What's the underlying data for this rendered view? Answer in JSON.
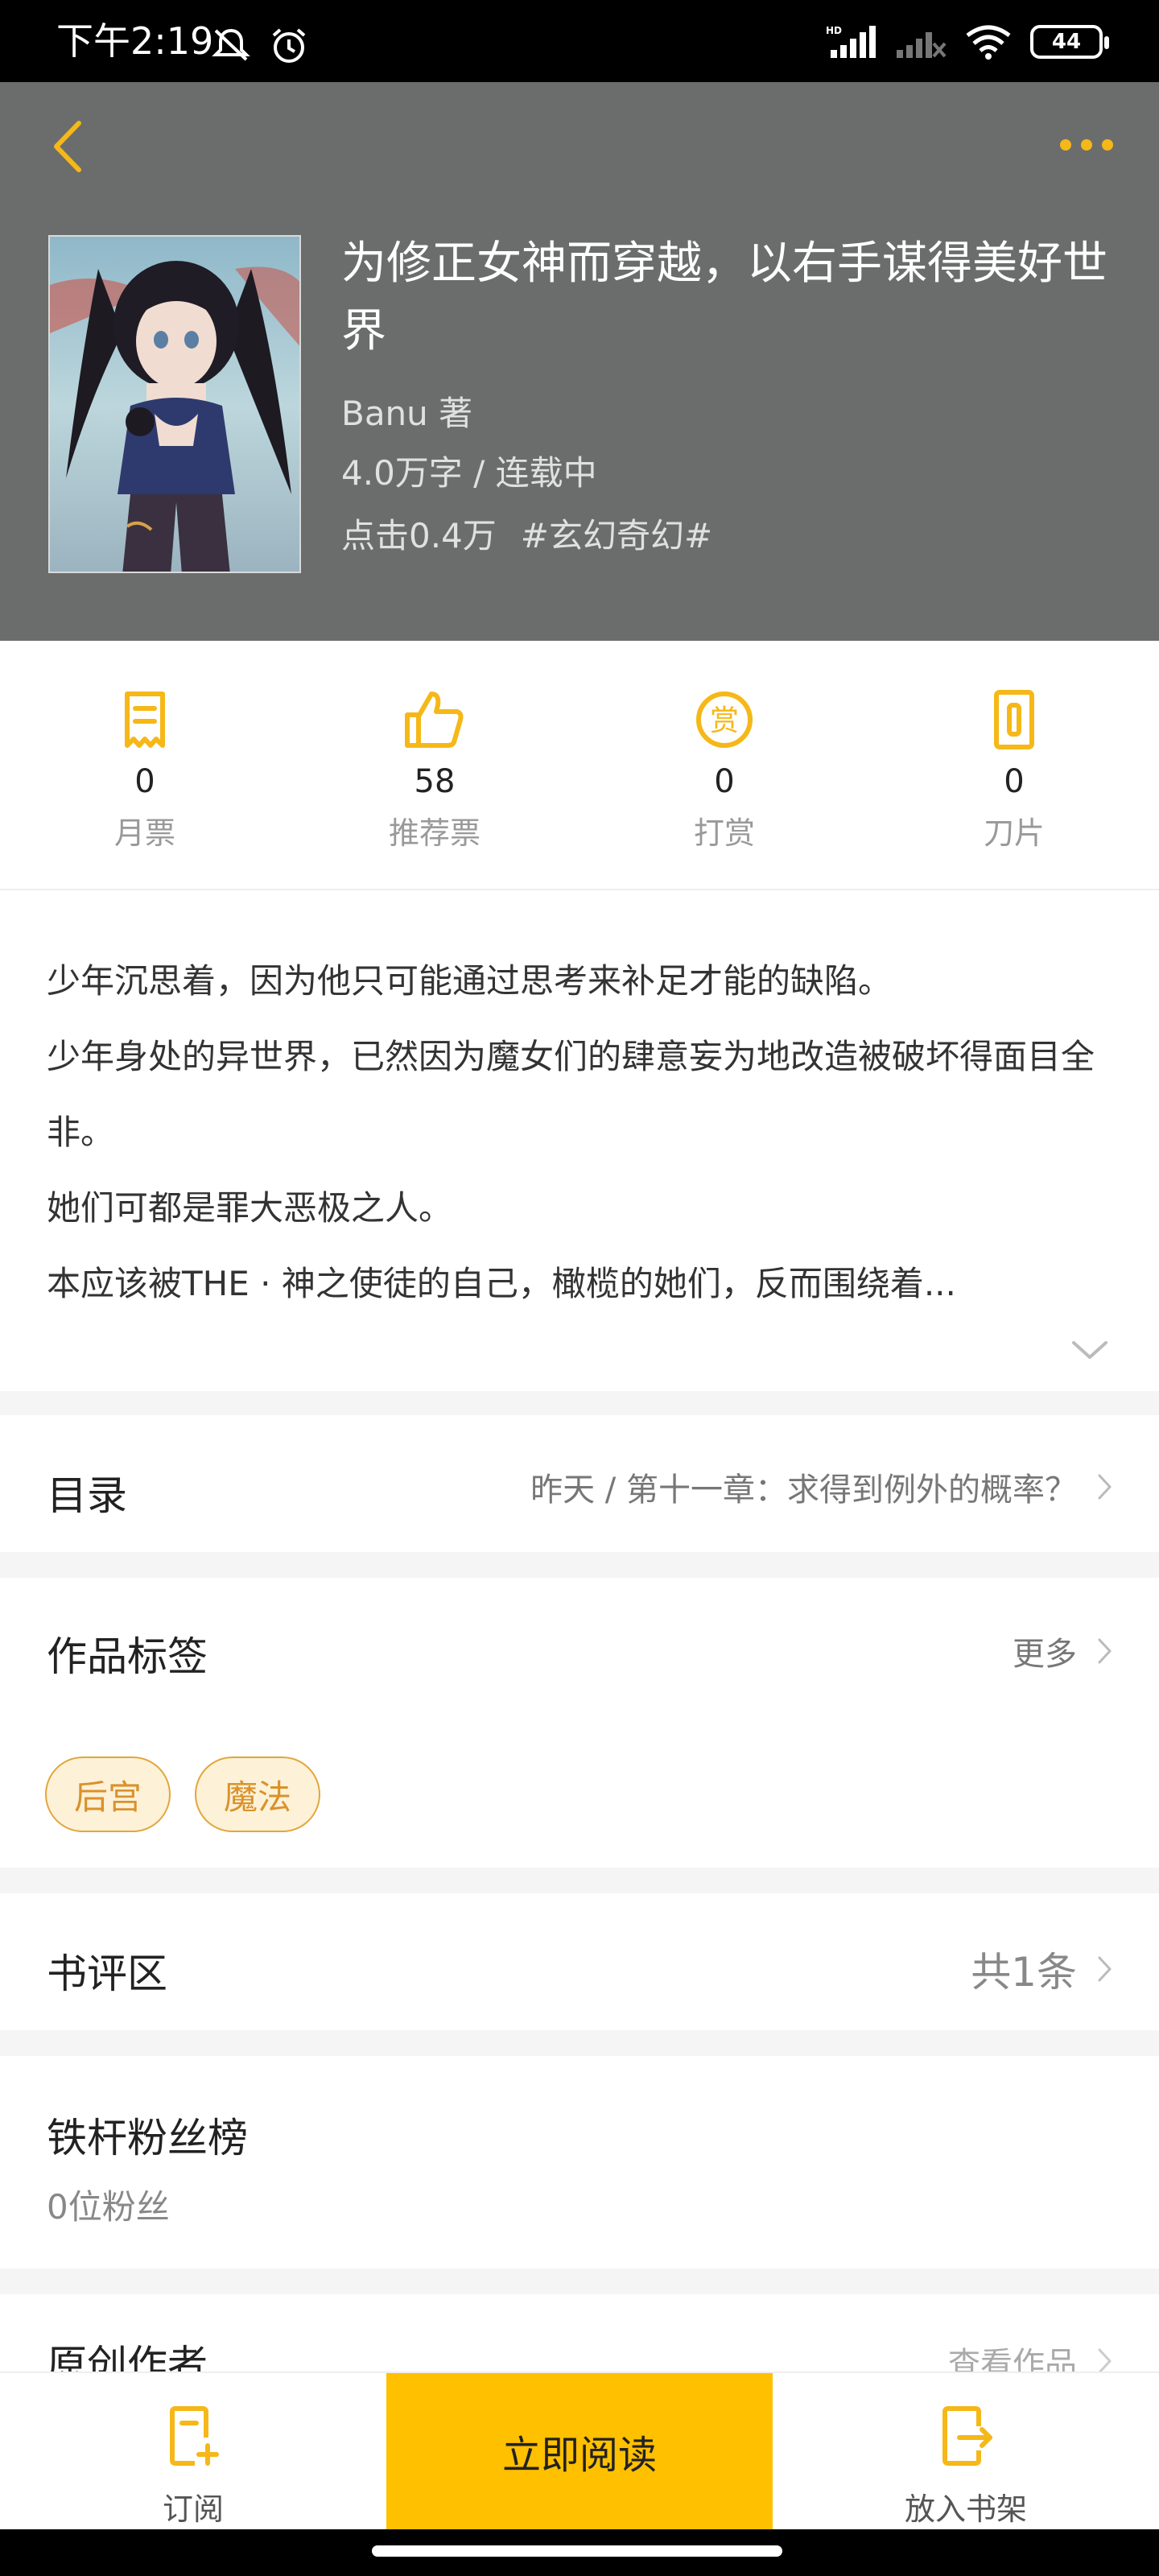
{
  "status_bar": {
    "time": "下午2:19",
    "battery": "44",
    "icons": [
      "mute-notification-icon",
      "alarm-icon",
      "signal-hd-icon",
      "signal-icon",
      "wifi-icon",
      "battery-icon"
    ]
  },
  "header": {
    "back_icon": "chevron-left-icon",
    "more_icon": "more-dots-icon"
  },
  "book": {
    "title": "为修正女神而穿越，以右手谋得美好世界",
    "author": "Banu  著",
    "words_status": "4.0万字 / 连载中",
    "clicks": "点击0.4万",
    "genre": "#玄幻奇幻#"
  },
  "stats": [
    {
      "value": "0",
      "label": "月票",
      "icon": "ticket-icon"
    },
    {
      "value": "58",
      "label": "推荐票",
      "icon": "thumbs-up-icon"
    },
    {
      "value": "0",
      "label": "打赏",
      "icon": "reward-icon"
    },
    {
      "value": "0",
      "label": "刀片",
      "icon": "blade-icon"
    }
  ],
  "synopsis": {
    "lines": [
      "少年沉思着，因为他只可能通过思考来补足才能的缺陷。",
      "少年身处的异世界，已然因为魔女们的肆意妄为地改造被破坏得面目全非。",
      "她们可都是罪大恶极之人。",
      "本应该被THE · 神之使徒的自己，橄榄的她们，反而围绕着..."
    ]
  },
  "toc": {
    "title": "目录",
    "latest": "昨天 / 第十一章：求得到例外的概率？"
  },
  "tags": {
    "title": "作品标签",
    "more": "更多",
    "items": [
      "后宫",
      "魔法"
    ]
  },
  "review": {
    "title": "书评区",
    "count": "共1条"
  },
  "fans": {
    "title": "铁杆粉丝榜",
    "count": "0位粉丝"
  },
  "author_section": {
    "title": "原创作者",
    "link": "查看作品"
  },
  "bottom_bar": {
    "subscribe": "订阅",
    "read_now": "立即阅读",
    "add_shelf": "放入书架"
  },
  "colors": {
    "accent": "#ffc000",
    "icon_accent": "#f5b818",
    "header_bg": "#6b6d6c"
  }
}
